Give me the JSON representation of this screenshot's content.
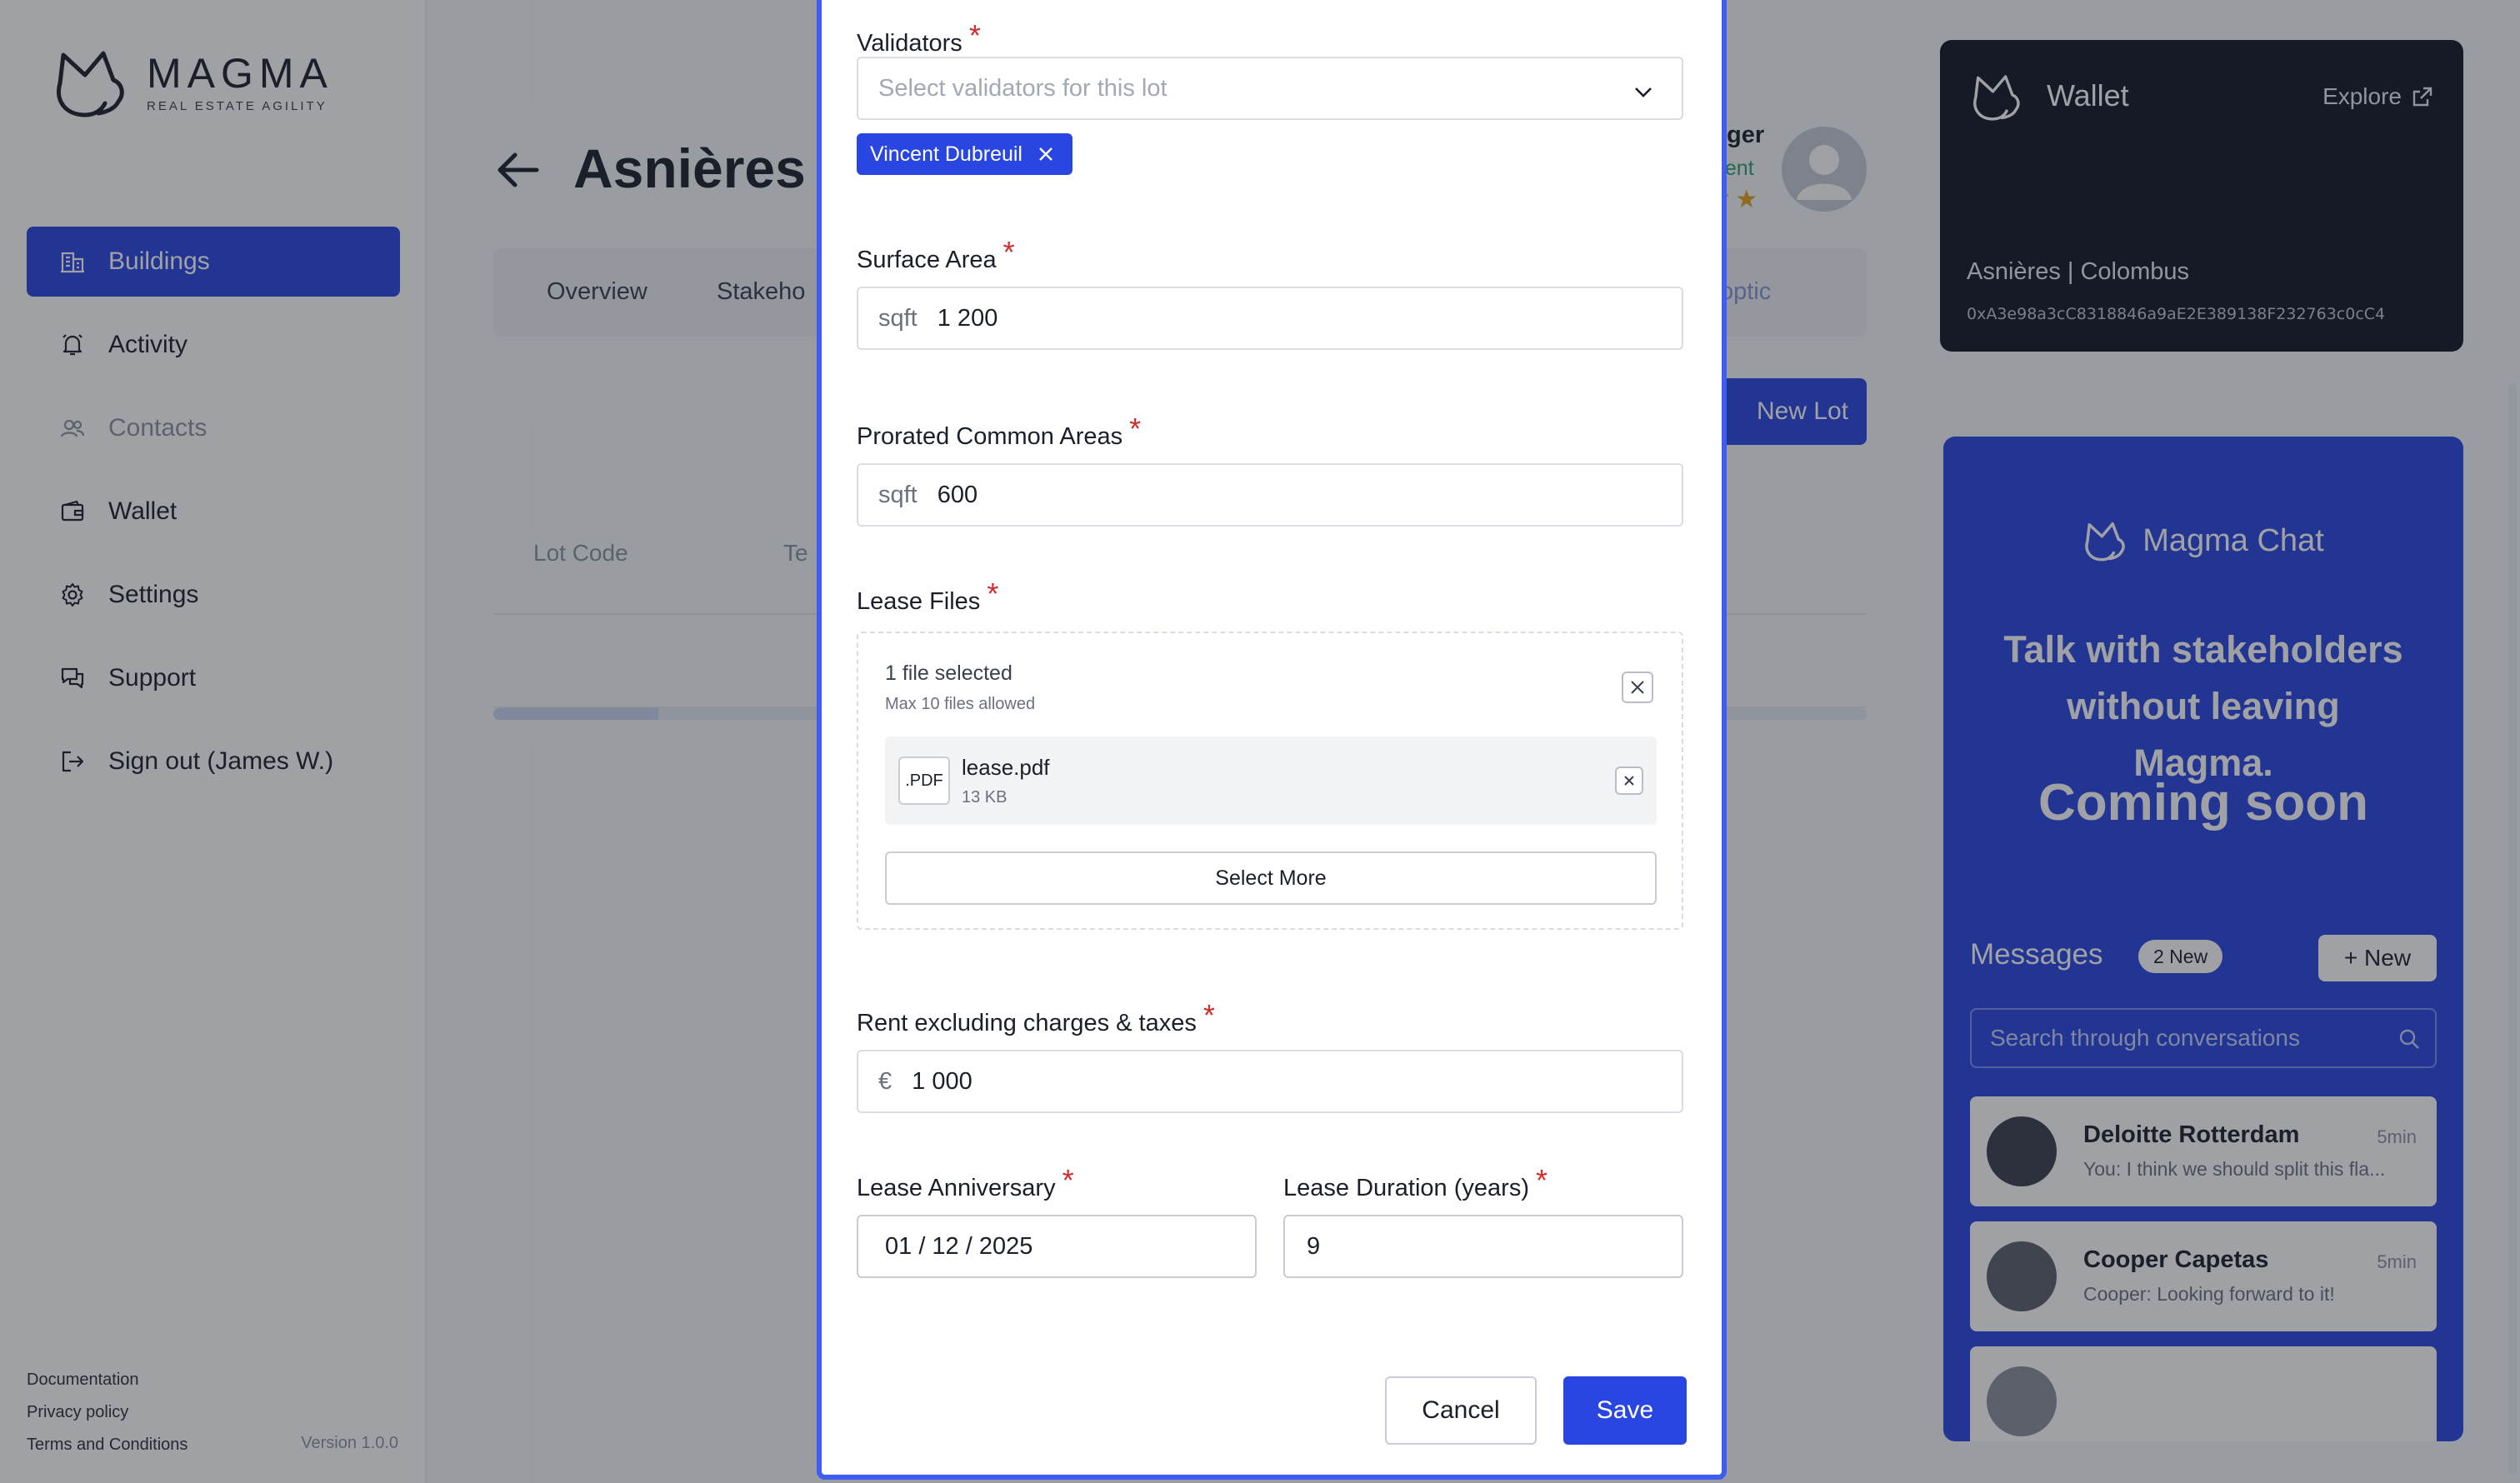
{
  "app": {
    "logo_name": "MAGMA",
    "logo_tagline": "REAL ESTATE AGILITY",
    "accent_color": "#2a46e0",
    "version": "Version 1.0.0"
  },
  "sidebar": {
    "items": [
      {
        "label": "Buildings",
        "icon": "buildings-icon",
        "active": true
      },
      {
        "label": "Activity",
        "icon": "bell-icon"
      },
      {
        "label": "Contacts",
        "icon": "contacts-icon"
      },
      {
        "label": "Wallet",
        "icon": "wallet-icon"
      },
      {
        "label": "Settings",
        "icon": "gear-icon"
      },
      {
        "label": "Support",
        "icon": "chat-bubbles-icon"
      },
      {
        "label": "Sign out (James W.)",
        "icon": "sign-out-icon"
      }
    ],
    "footer": {
      "documentation": "Documentation",
      "privacy": "Privacy policy",
      "terms": "Terms and Conditions"
    }
  },
  "page": {
    "title": "Asnières |",
    "tabs": [
      "Overview",
      "Stakeho",
      "optic"
    ],
    "user": {
      "name": "ger",
      "role": "nent",
      "rating_text": "r ★"
    },
    "new_lot_label": "New Lot",
    "columns": [
      "Lot Code",
      "Te"
    ],
    "progress": 0.12
  },
  "wallet_card": {
    "title": "Wallet",
    "explore_label": "Explore",
    "building_name": "Asnières | Colombus",
    "address": "0xA3e98a3cC8318846a9aE2E389138F232763c0cC4"
  },
  "chat": {
    "brand": "Magma Chat",
    "tagline": "Talk with stakeholders without leaving Magma.",
    "coming_soon": "Coming soon",
    "messages_label": "Messages",
    "new_badge": "2 New",
    "new_button": "+ New",
    "search_placeholder": "Search through conversations",
    "conversations": [
      {
        "name": "Deloitte Rotterdam",
        "time": "5min",
        "message": "You: I think we should split this fla..."
      },
      {
        "name": "Cooper Capetas",
        "time": "5min",
        "message": "Cooper: Looking forward to it!"
      }
    ]
  },
  "modal": {
    "validators": {
      "label": "Validators",
      "placeholder": "Select validators for this lot",
      "selected": [
        "Vincent Dubreuil"
      ]
    },
    "surface_area": {
      "label": "Surface Area",
      "unit": "sqft",
      "value": "1 200"
    },
    "prorated": {
      "label": "Prorated Common Areas",
      "unit": "sqft",
      "value": "600"
    },
    "lease_files": {
      "label": "Lease Files",
      "count_text": "1 file selected",
      "max_text": "Max 10 files allowed",
      "files": [
        {
          "ext": ".PDF",
          "name": "lease.pdf",
          "size": "13 KB"
        }
      ],
      "select_more": "Select More"
    },
    "rent": {
      "label": "Rent excluding charges & taxes",
      "unit": "€",
      "value": "1 000"
    },
    "anniversary": {
      "label": "Lease Anniversary",
      "value": "01 / 12 / 2025"
    },
    "duration": {
      "label": "Lease Duration (years)",
      "value": "9"
    },
    "cancel_label": "Cancel",
    "save_label": "Save",
    "required_mark": "*"
  }
}
